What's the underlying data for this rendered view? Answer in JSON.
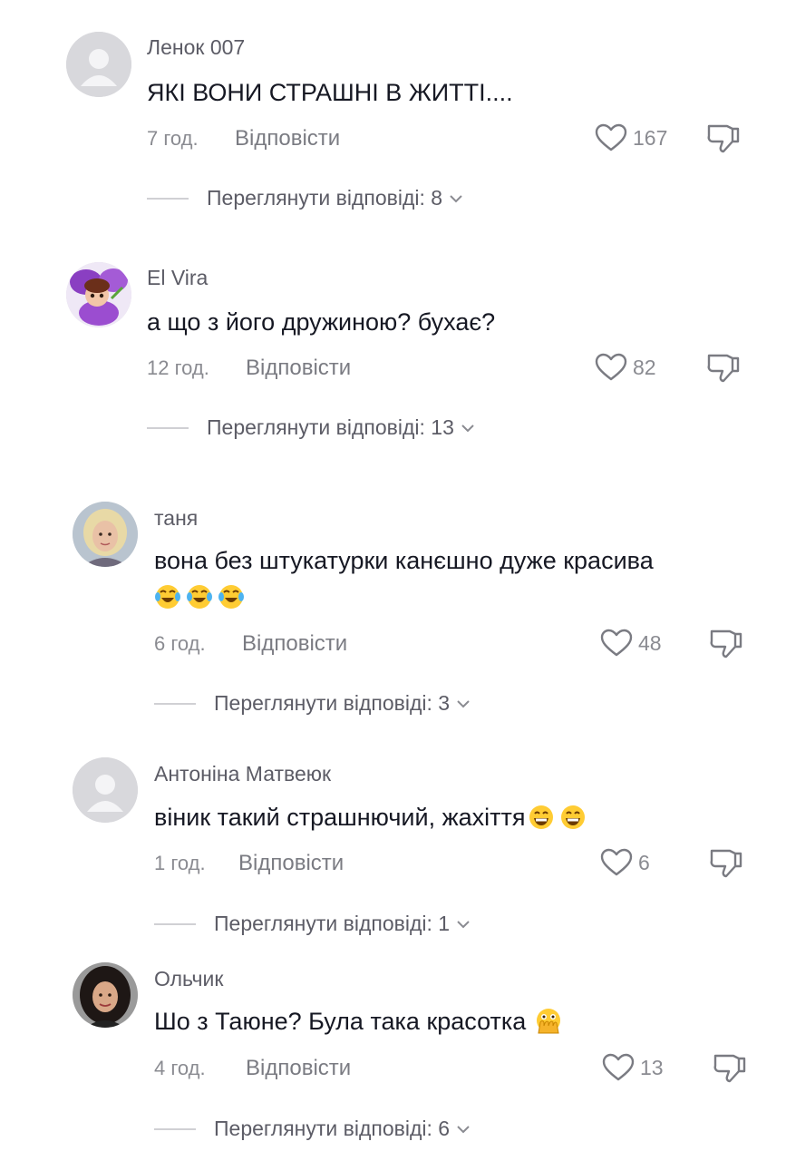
{
  "comments": [
    {
      "username": "Ленок 007",
      "text": "ЯКІ ВОНИ СТРАШНІ В ЖИТТІ....",
      "emojis": [],
      "time": "7 год.",
      "reply_label": "Відповісти",
      "likes": "167",
      "view_replies": "Переглянути відповіді: 8",
      "avatar": "default-avatar-icon"
    },
    {
      "username": "El Vira",
      "text": "а що з його дружиною? бухає?",
      "emojis": [],
      "time": "12 год.",
      "reply_label": "Відповісти",
      "likes": "82",
      "view_replies": "Переглянути відповіді: 13",
      "avatar": "doll-photo"
    },
    {
      "username": "таня",
      "text": "вона без штукатурки канєшно дуже красива",
      "emojis": [
        "tears-of-joy-emoji",
        "tears-of-joy-emoji",
        "tears-of-joy-emoji"
      ],
      "time": "6 год.",
      "reply_label": "Відповісти",
      "likes": "48",
      "view_replies": "Переглянути відповіді: 3",
      "avatar": "woman-photo-blonde"
    },
    {
      "username": "Антоніна Матвеюк",
      "text": "віник такий страшнючий, жахіття",
      "emojis": [
        "grinning-emoji",
        "grinning-emoji"
      ],
      "time": "1 год.",
      "reply_label": "Відповісти",
      "likes": "6",
      "view_replies": "Переглянути відповіді: 1",
      "avatar": "default-avatar-icon"
    },
    {
      "username": "Ольчик",
      "text": "Шо з Таюне? Була така красотка",
      "emojis": [
        "face-with-open-eyes-and-hand-over-mouth-emoji"
      ],
      "time": "4 год.",
      "reply_label": "Відповісти",
      "likes": "13",
      "view_replies": "Переглянути відповіді: 6",
      "avatar": "woman-photo-dark-hair"
    }
  ],
  "colors": {
    "text_primary": "#161823",
    "text_secondary": "#8a8b91",
    "divider": "#d0d0d4"
  }
}
